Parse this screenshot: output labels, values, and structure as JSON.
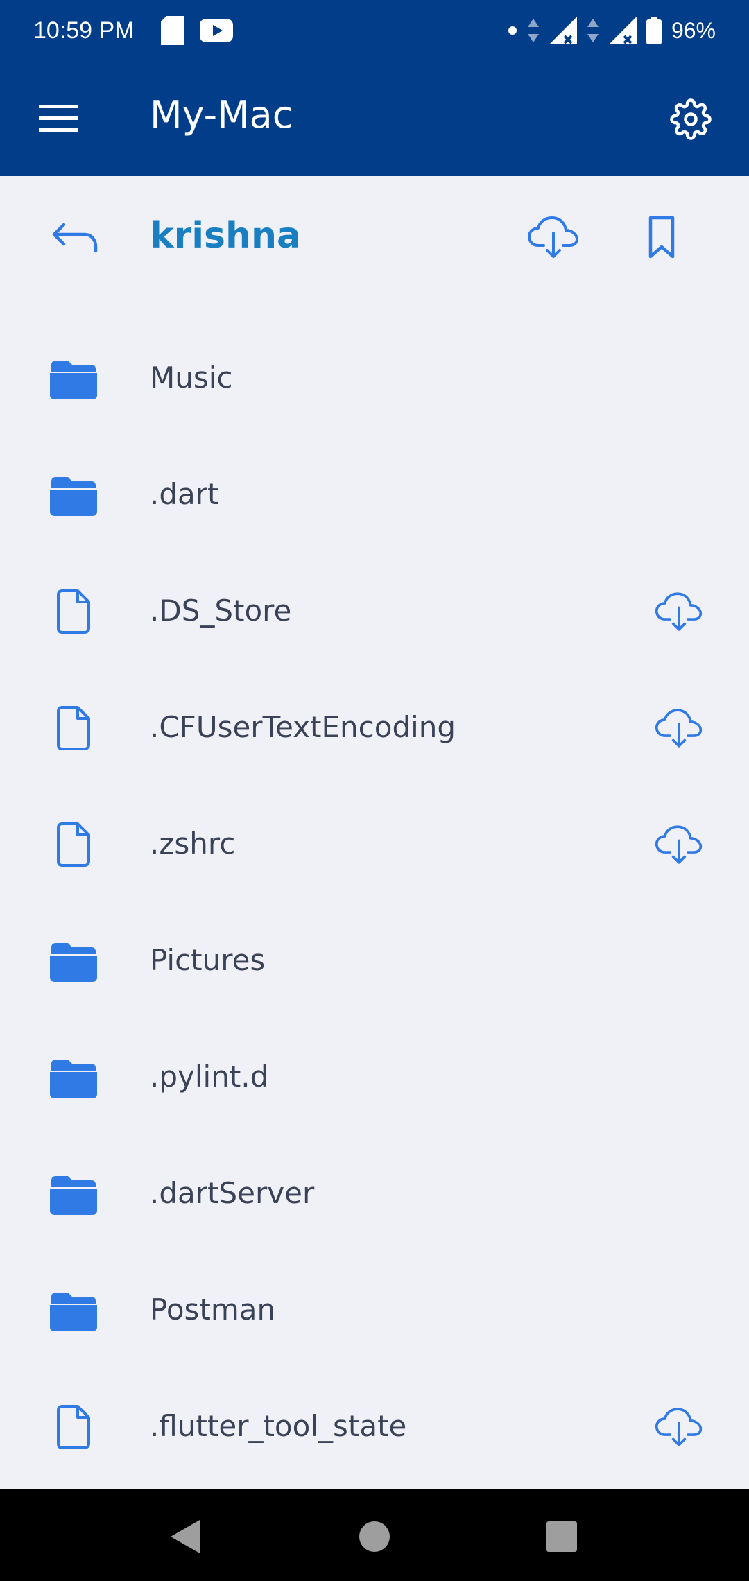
{
  "status_bar": {
    "time": "10:59 PM",
    "battery": "96%",
    "icons": [
      "sd-card-icon",
      "youtube-icon",
      "dot-icon",
      "data-arrows-icon",
      "signal-icon",
      "signal-icon",
      "battery-icon"
    ]
  },
  "app_bar": {
    "title": "My-Mac",
    "menu_icon": "hamburger-menu-icon",
    "settings_icon": "gear-icon"
  },
  "header": {
    "folder_name": "krishna",
    "back_icon": "back-arrow-icon",
    "download_icon": "cloud-download-icon",
    "bookmark_icon": "bookmark-icon"
  },
  "files": [
    {
      "name": "Music",
      "type": "folder"
    },
    {
      "name": ".dart",
      "type": "folder"
    },
    {
      "name": ".DS_Store",
      "type": "file"
    },
    {
      "name": ".CFUserTextEncoding",
      "type": "file"
    },
    {
      "name": ".zshrc",
      "type": "file"
    },
    {
      "name": "Pictures",
      "type": "folder"
    },
    {
      "name": ".pylint.d",
      "type": "folder"
    },
    {
      "name": ".dartServer",
      "type": "folder"
    },
    {
      "name": "Postman",
      "type": "folder"
    },
    {
      "name": ".flutter_tool_state",
      "type": "file"
    }
  ],
  "colors": {
    "app_bar": "#023d8a",
    "accent": "#2f7ae5",
    "folder_title": "#1a7fc1",
    "background": "#f0f1f7",
    "text": "#3a4257"
  },
  "nav_bar": {
    "icons": [
      "back-triangle-icon",
      "home-circle-icon",
      "recents-square-icon"
    ]
  }
}
